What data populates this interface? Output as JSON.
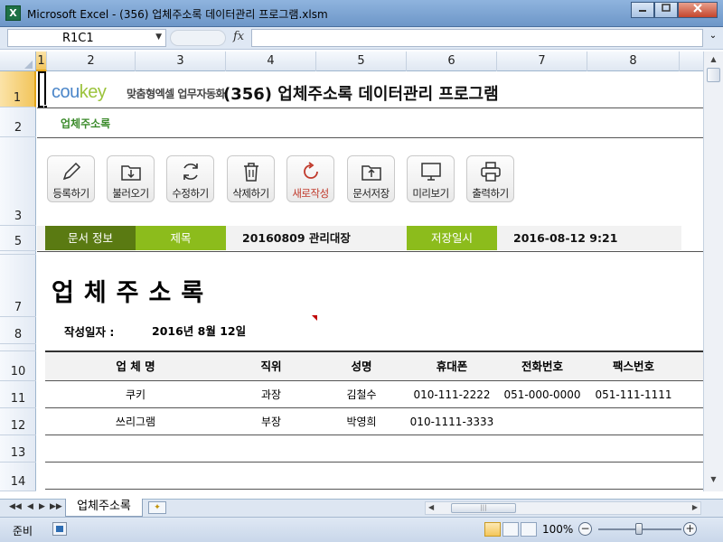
{
  "window": {
    "app_icon": "X",
    "title": "Microsoft Excel - (356) 업체주소록 데이터관리 프로그램.xlsm",
    "min_icon": "minimize-icon",
    "max_icon": "maximize-icon",
    "close_icon": "close-icon"
  },
  "formula_bar": {
    "name_box": "R1C1",
    "fx_label": "fx",
    "formula": ""
  },
  "columns": [
    "1",
    "2",
    "3",
    "4",
    "5",
    "6",
    "7",
    "8"
  ],
  "rows": [
    "1",
    "2",
    "3",
    "5",
    "7",
    "8",
    "10",
    "11",
    "12",
    "13",
    "14"
  ],
  "header": {
    "logo_part1": "cou",
    "logo_part2": "key",
    "logo_sub": "맞춤형엑셀 업무자동화",
    "title": "(356) 업체주소록 데이터관리 프로그램",
    "sheet_label": "업체주소록"
  },
  "toolbar": [
    {
      "label": "등록하기",
      "icon": "pencil-icon"
    },
    {
      "label": "불러오기",
      "icon": "folder-download-icon"
    },
    {
      "label": "수정하기",
      "icon": "refresh-icon"
    },
    {
      "label": "삭제하기",
      "icon": "trash-icon"
    },
    {
      "label": "새로작성",
      "icon": "new-refresh-icon"
    },
    {
      "label": "문서저장",
      "icon": "folder-upload-icon"
    },
    {
      "label": "미리보기",
      "icon": "monitor-icon"
    },
    {
      "label": "출력하기",
      "icon": "printer-icon"
    }
  ],
  "doc_info": {
    "section_label": "문서 정보",
    "title_label": "제목",
    "title_value": "20160809 관리대장",
    "saved_label": "저장일시",
    "saved_value": "2016-08-12 9:21"
  },
  "document": {
    "heading": "업체주소록",
    "date_label": "작성일자 :",
    "date_value": "2016년 8월 12일"
  },
  "table": {
    "headers": [
      "업 체 명",
      "직위",
      "성명",
      "휴대폰",
      "전화번호",
      "팩스번호"
    ],
    "rows": [
      [
        "쿠키",
        "과장",
        "김철수",
        "010-111-2222",
        "051-000-0000",
        "051-111-1111"
      ],
      [
        "쓰리그램",
        "부장",
        "박영희",
        "010-1111-3333",
        "",
        ""
      ],
      [
        "",
        "",
        "",
        "",
        "",
        ""
      ],
      [
        "",
        "",
        "",
        "",
        "",
        ""
      ]
    ]
  },
  "tabs": {
    "active": "업체주소록"
  },
  "status": {
    "ready": "준비",
    "zoom": "100%",
    "zoom_fraction": 0.5
  },
  "colors": {
    "dark_green": "#5a7a12",
    "light_green": "#8cbc1c",
    "accent_green": "#3a8a2a",
    "logo_blue": "#4b86c9",
    "logo_green": "#9bc33b"
  }
}
